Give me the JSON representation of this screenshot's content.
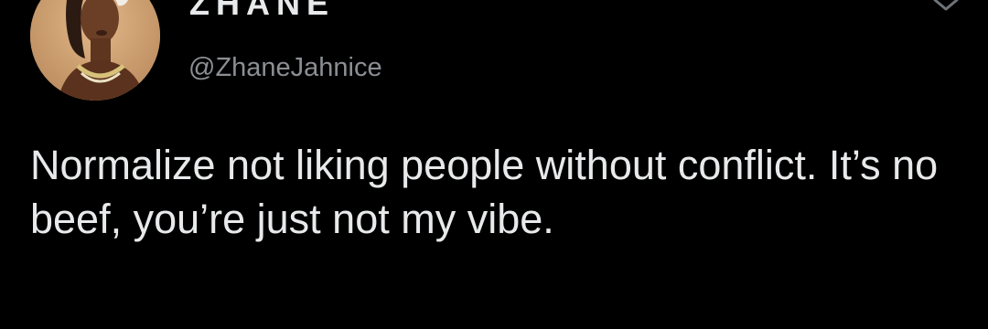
{
  "tweet": {
    "display_name": "ZHANE",
    "handle": "@ZhaneJahnice",
    "text": "Normalize not liking people without conflict. It’s no beef, you’re just not my vibe."
  },
  "icons": {
    "more": "chevron-down-icon"
  },
  "colors": {
    "background": "#000000",
    "text": "#e7e9ea",
    "secondary": "#8b8f94"
  }
}
